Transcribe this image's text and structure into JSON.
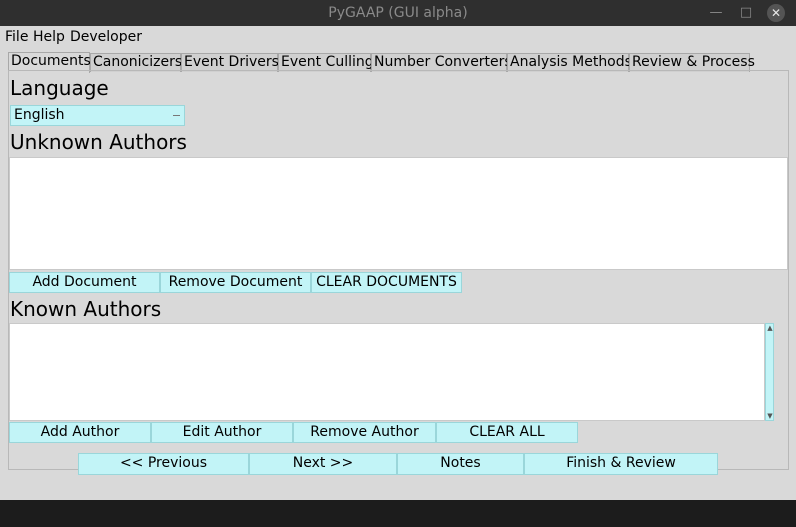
{
  "window": {
    "title": "PyGAAP (GUI alpha)"
  },
  "menu": [
    "File",
    "Help",
    "Developer"
  ],
  "tabs": [
    "Documents",
    "Canonicizers",
    "Event Drivers",
    "Event Culling",
    "Number Converters",
    "Analysis Methods",
    "Review & Process"
  ],
  "active_tab": "Documents",
  "language": {
    "heading": "Language",
    "selected": "English"
  },
  "unknown_authors": {
    "heading": "Unknown Authors",
    "items": [],
    "buttons": [
      "Add Document",
      "Remove Document",
      "CLEAR DOCUMENTS"
    ]
  },
  "known_authors": {
    "heading": "Known Authors",
    "items": [],
    "buttons": [
      "Add Author",
      "Edit Author",
      "Remove Author",
      "CLEAR ALL"
    ]
  },
  "nav_buttons": [
    "<< Previous",
    "Next >>",
    "Notes",
    "Finish & Review"
  ],
  "colors": {
    "button_bg": "#c2f4f7",
    "window_bg": "#d9d9d9",
    "titlebar_bg": "#2f2f2f"
  }
}
